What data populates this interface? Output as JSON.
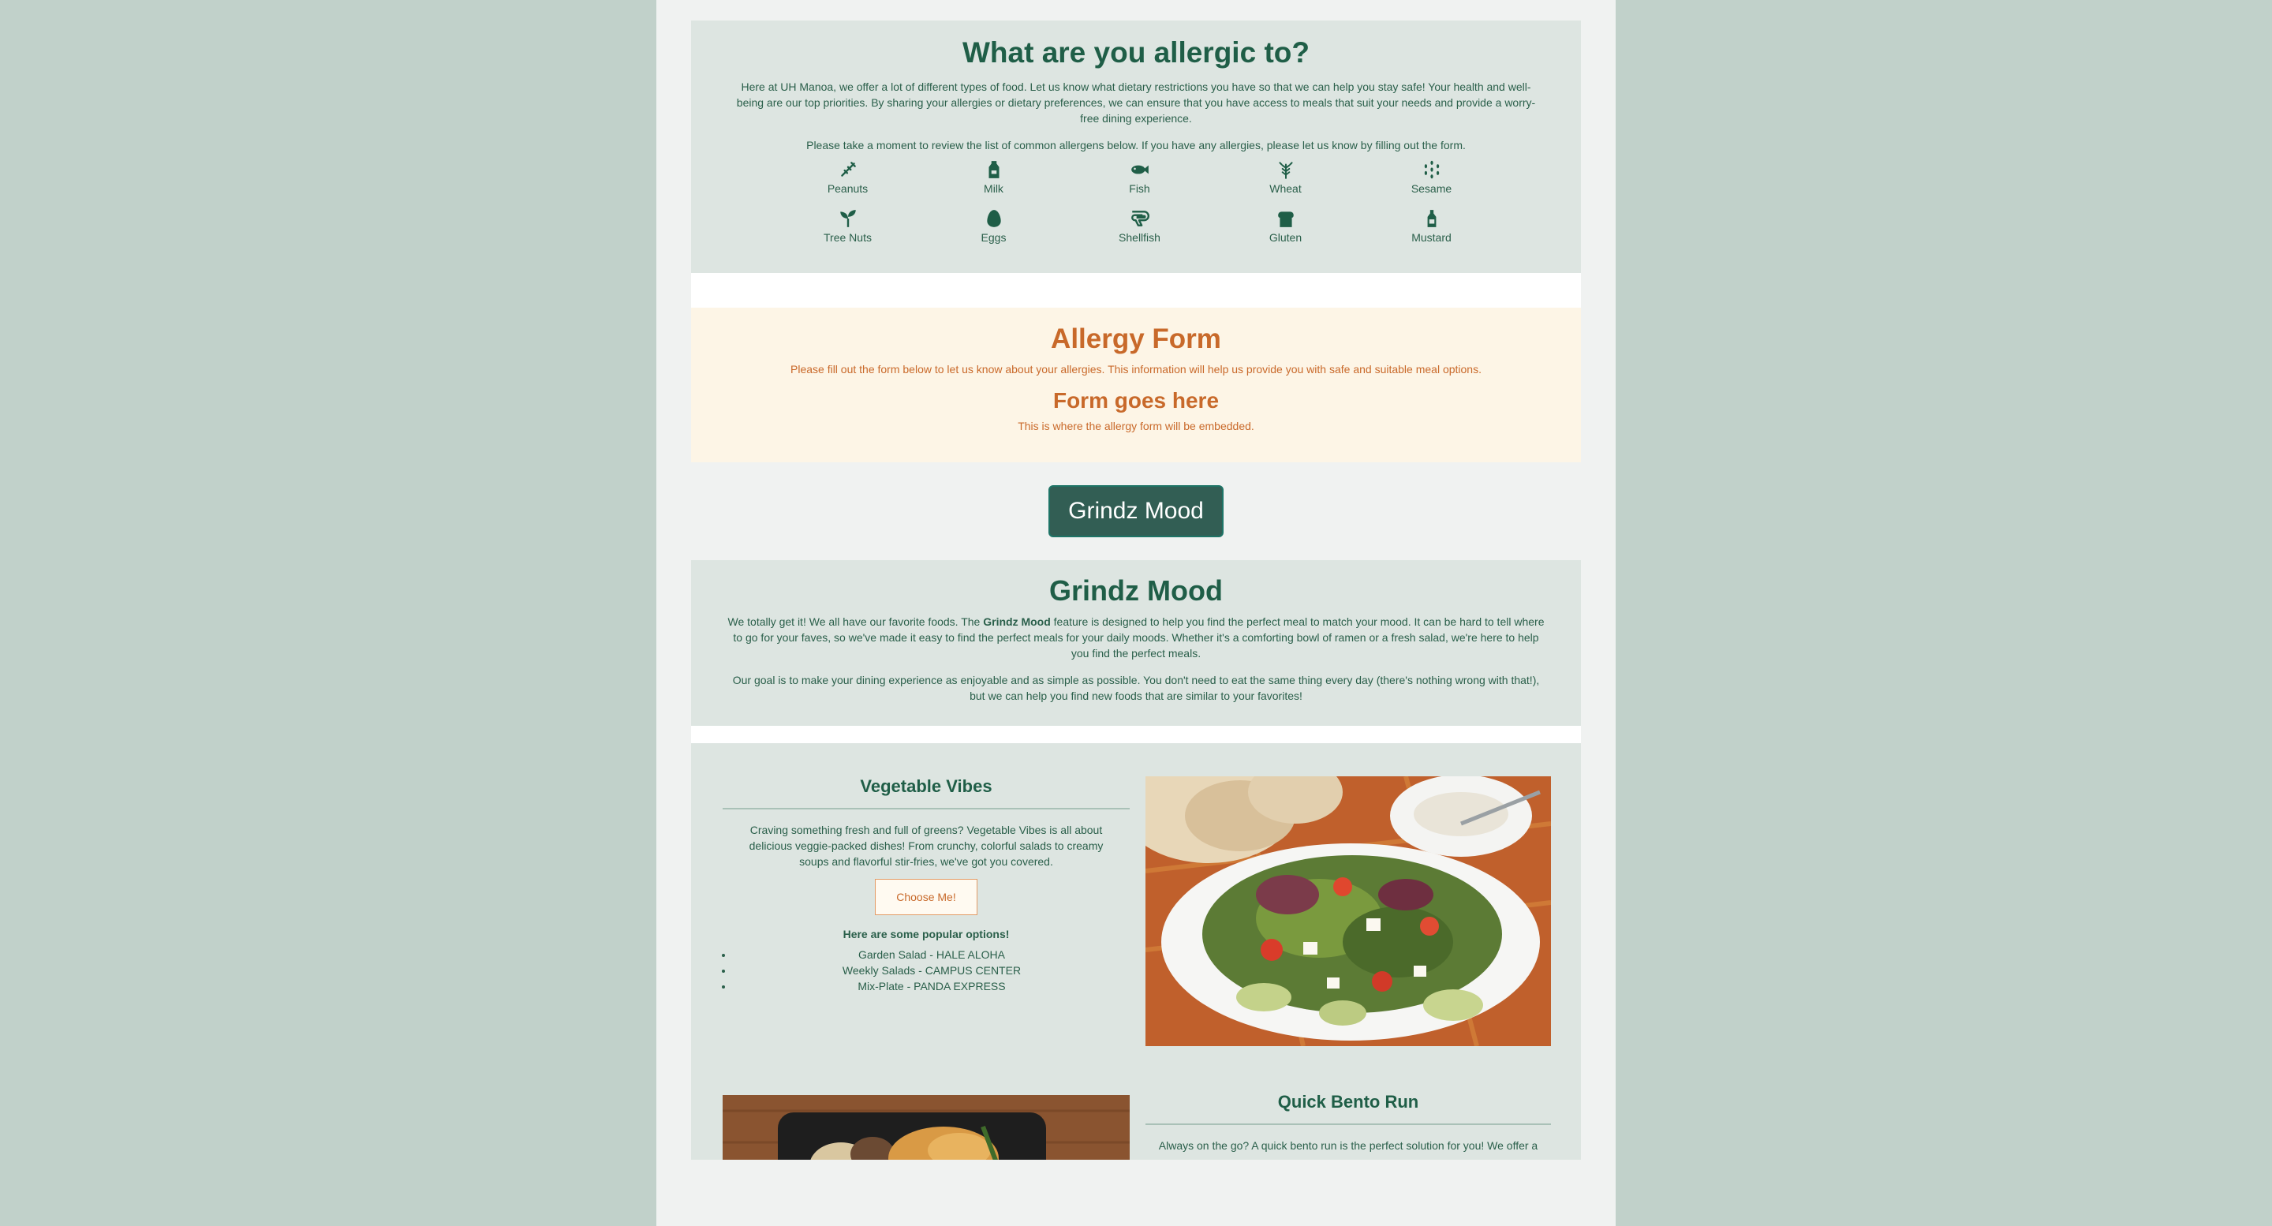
{
  "allergens": {
    "title": "What are you allergic to?",
    "intro": "Here at UH Manoa, we offer a lot of different types of food. Let us know what dietary restrictions you have so that we can help you stay safe! Your health and well-being are our top priorities. By sharing your allergies or dietary preferences, we can ensure that you have access to meals that suit your needs and provide a worry-free dining experience.",
    "note": "Please take a moment to review the list of common allergens below. If you have any allergies, please let us know by filling out the form.",
    "items": [
      {
        "label": "Peanuts",
        "icon": "peanut-icon"
      },
      {
        "label": "Milk",
        "icon": "milk-icon"
      },
      {
        "label": "Fish",
        "icon": "fish-icon"
      },
      {
        "label": "Wheat",
        "icon": "wheat-icon"
      },
      {
        "label": "Sesame",
        "icon": "sesame-icon"
      },
      {
        "label": "Tree Nuts",
        "icon": "sprout-icon"
      },
      {
        "label": "Eggs",
        "icon": "egg-icon"
      },
      {
        "label": "Shellfish",
        "icon": "shrimp-icon"
      },
      {
        "label": "Gluten",
        "icon": "bread-icon"
      },
      {
        "label": "Mustard",
        "icon": "bottle-icon"
      }
    ]
  },
  "form": {
    "title": "Allergy Form",
    "description": "Please fill out the form below to let us know about your allergies. This information will help us provide you with safe and suitable meal options.",
    "placeholder_title": "Form goes here",
    "placeholder_text": "This is where the allergy form will be embedded."
  },
  "mood_button": {
    "label": "Grindz Mood"
  },
  "mood": {
    "title": "Grindz Mood",
    "p1_before": "We totally get it! We all have our favorite foods. The ",
    "p1_bold": "Grindz Mood",
    "p1_after": " feature is designed to help you find the perfect meal to match your mood. It can be hard to tell where to go for your faves, so we've made it easy to find the perfect meals for your daily moods. Whether it's a comforting bowl of ramen or a fresh salad, we're here to help you find the perfect meals.",
    "p2": "Our goal is to make your dining experience as enjoyable and as simple as possible. You don't need to eat the same thing every day (there's nothing wrong with that!), but we can help you find new foods that are similar to your favorites!"
  },
  "cards": [
    {
      "title": "Vegetable Vibes",
      "description": "Craving something fresh and full of greens? Vegetable Vibes is all about delicious veggie-packed dishes! From crunchy, colorful salads to creamy soups and flavorful stir-fries, we've got you covered.",
      "button": "Choose Me!",
      "popular_heading": "Here are some popular options!",
      "options": [
        "Garden Salad - HALE ALOHA",
        "Weekly Salads - CAMPUS CENTER",
        "Mix-Plate - PANDA EXPRESS"
      ]
    },
    {
      "title": "Quick Bento Run",
      "description": "Always on the go? A quick bento run is the perfect solution for you! We offer a"
    }
  ],
  "colors": {
    "outer_bg": "#c1d1ca",
    "page_bg": "#f0f2f1",
    "section_bg": "#dde5e1",
    "form_bg": "#fdf5e6",
    "green_text": "#1f5e47",
    "orange_text": "#c8692a",
    "button_bg": "#325e54"
  }
}
